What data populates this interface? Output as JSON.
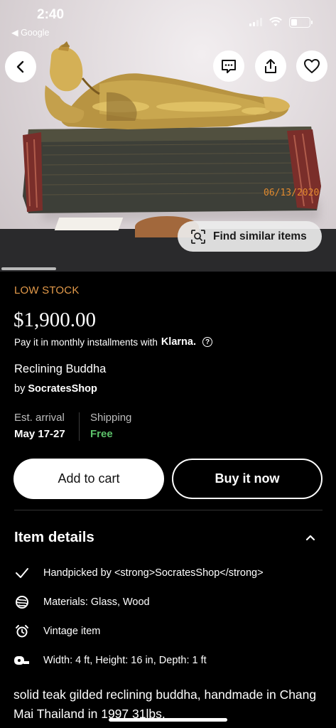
{
  "status_bar": {
    "time": "2:40",
    "back_app": "◀ Google"
  },
  "hero": {
    "date_stamp": "06/13/2020",
    "find_similar_label": "Find similar items"
  },
  "icons": {
    "back": "chevron-left-icon",
    "message": "message-icon",
    "share": "share-icon",
    "favorite": "heart-icon",
    "visual_search": "visual-search-icon"
  },
  "listing": {
    "stock_status": "LOW STOCK",
    "price": "$1,900.00",
    "installments_text": "Pay it in monthly installments with",
    "klarna_label": "Klarna.",
    "help_glyph": "?",
    "title": "Reclining Buddha",
    "by_prefix": "by",
    "shop_name": "SocratesShop",
    "est_arrival_label": "Est. arrival",
    "est_arrival_value": "May 17-27",
    "shipping_label": "Shipping",
    "shipping_value": "Free"
  },
  "actions": {
    "add_to_cart": "Add to cart",
    "buy_now": "Buy it now"
  },
  "item_details": {
    "heading": "Item details",
    "rows": [
      {
        "icon": "checkmark-icon",
        "text": "Handpicked by <strong>SocratesShop</strong>"
      },
      {
        "icon": "materials-icon",
        "text": "Materials: Glass, Wood"
      },
      {
        "icon": "alarm-clock-icon",
        "text": "Vintage item"
      },
      {
        "icon": "tape-measure-icon",
        "text": "Width: 4 ft, Height: 16 in, Depth: 1 ft"
      }
    ],
    "description": "solid teak gilded reclining buddha, handmade in Chang Mai Thailand in 1997 31lbs."
  },
  "colors": {
    "background": "#000000",
    "low_stock": "#e39a4a",
    "free_shipping": "#5cc26a"
  }
}
